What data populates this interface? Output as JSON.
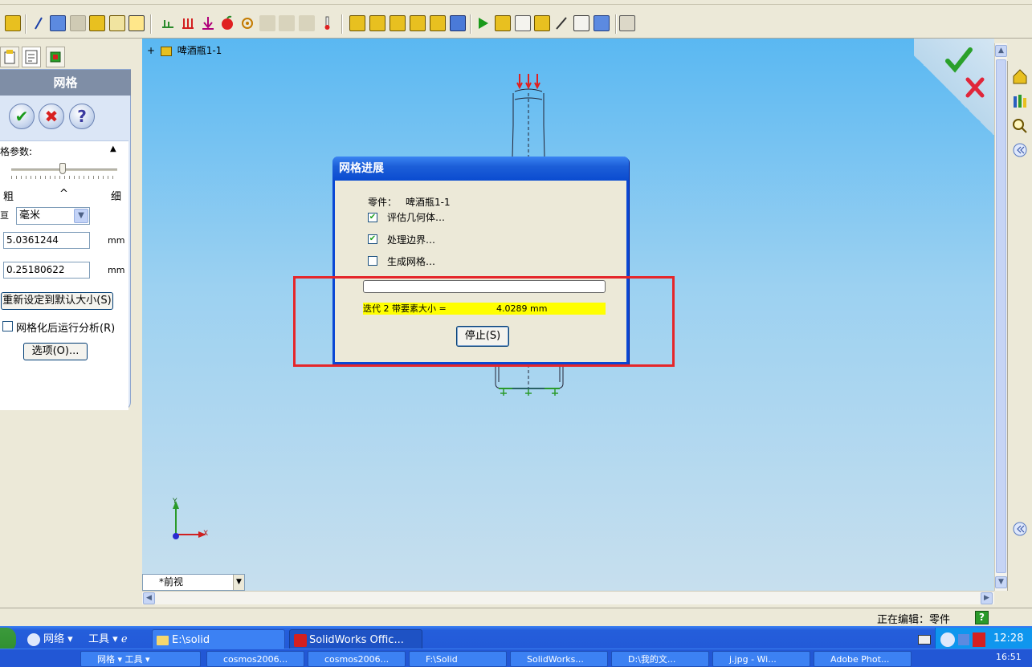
{
  "feature_manager": {
    "tree_root": "啤酒瓶1-1"
  },
  "property_manager": {
    "title": "网格",
    "ok_icon": "green-check",
    "cancel_icon": "red-x",
    "help_icon": "question-mark",
    "section_title": "格参数:",
    "slider_left_label": "粗",
    "slider_right_label": "细",
    "slider_marker": "^",
    "unit_label": "亘",
    "unit_select": "毫米",
    "global_size": "5.0361244",
    "global_unit": "mm",
    "tolerance": "0.25180622",
    "tolerance_unit": "mm",
    "reset_button": "重新设定到默认大小(S)",
    "run_analysis_label": "网格化后运行分析(R)",
    "run_analysis_checked": false,
    "options_button": "选项(O)..."
  },
  "viewport": {
    "view_name": "*前视",
    "axis_x": "X",
    "axis_y": "Y",
    "confirm_ok_icon": "green-check",
    "confirm_cancel_icon": "red-x"
  },
  "dialog": {
    "title": "网格进展",
    "part_label": "零件：",
    "part_name": "啤酒瓶1-1",
    "steps": [
      {
        "label": "评估几何体…",
        "checked": true
      },
      {
        "label": "处理边界…",
        "checked": true
      },
      {
        "label": "生成网格…",
        "checked": false
      }
    ],
    "progress": 0,
    "status_text": "迭代 2 带要素大小 =",
    "status_value": "4.0289 mm",
    "stop_button": "停止(S)",
    "highlight_color": "#ffff00",
    "annotation_color": "#e5262a"
  },
  "statusbar": {
    "mode_text": "正在编辑：零件",
    "help_icon": "question-mark"
  },
  "taskbar": {
    "items": [
      {
        "label": "网络",
        "icon": "network-icon"
      },
      {
        "label": "工具",
        "icon": "tools-icon"
      },
      {
        "label": "E:\\solid",
        "icon": "folder-icon"
      },
      {
        "label": "SolidWorks Offic...",
        "icon": "solidworks-icon"
      }
    ],
    "clock": "12:28",
    "lower_items": [
      "网格 ▾ 工具 ▾",
      "cosmos2006...",
      "cosmos2006...",
      "F:\\Solid",
      "SolidWorks...",
      "D:\\我的文...",
      "j.jpg - Wi...",
      "Adobe Phot..."
    ],
    "lower_clock": "16:51"
  }
}
